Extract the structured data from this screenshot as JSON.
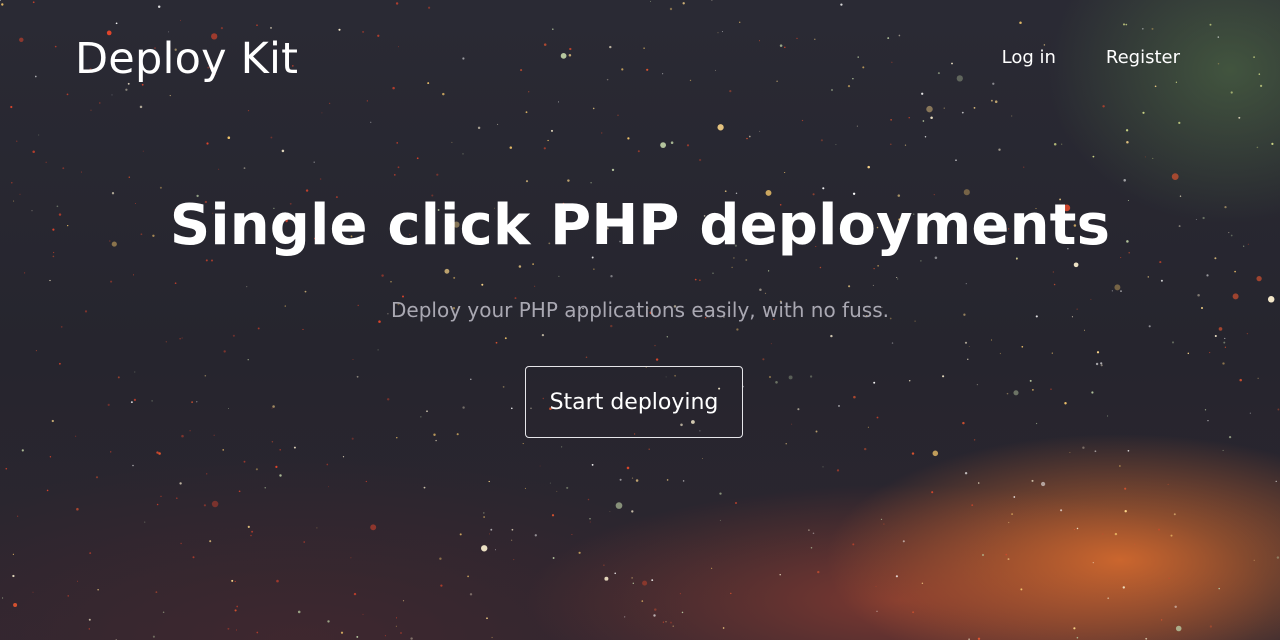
{
  "header": {
    "brand": "Deploy Kit",
    "nav": {
      "login_label": "Log in",
      "register_label": "Register"
    }
  },
  "hero": {
    "headline": "Single click PHP deployments",
    "tagline": "Deploy your PHP applications easily, with no fuss.",
    "cta_label": "Start deploying"
  },
  "colors": {
    "text": "#ffffff",
    "tagline_text": "#a9a8b2",
    "background": "#26252e",
    "glow_orange": "#e2702e",
    "glow_green": "#567848"
  }
}
